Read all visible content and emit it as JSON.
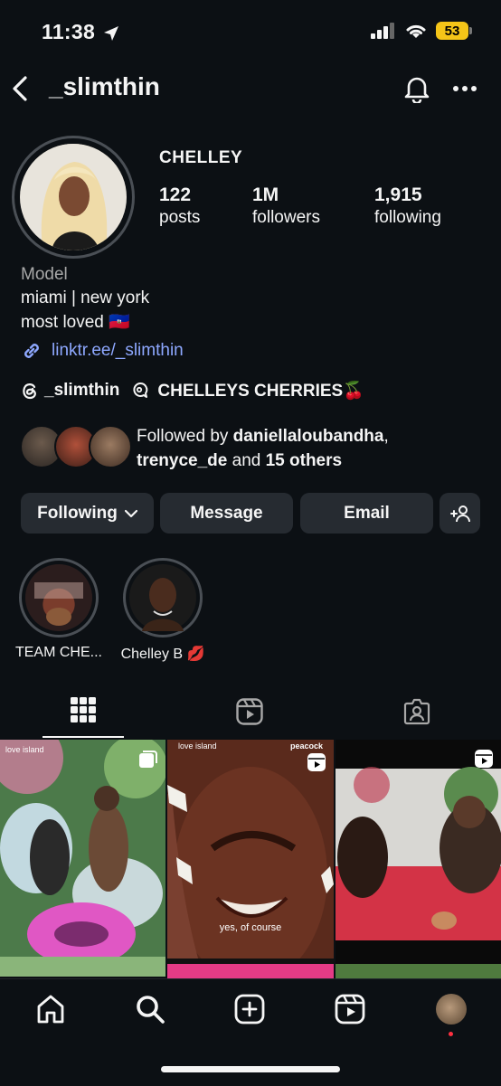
{
  "status_bar": {
    "time": "11:38",
    "battery": "53"
  },
  "header": {
    "username": "_slimthin"
  },
  "profile": {
    "display_name": "CHELLEY",
    "stats": [
      {
        "value": "122",
        "label": "posts"
      },
      {
        "value": "1M",
        "label": "followers"
      },
      {
        "value": "1,915",
        "label": "following"
      }
    ],
    "category": "Model",
    "bio_lines": [
      "miami | new york",
      "most loved 🇭🇹"
    ],
    "link": "linktr.ee/_slimthin",
    "threads_handle": "_slimthin",
    "channel_name": "CHELLEYS CHERRIES🍒",
    "followed_by": {
      "prefix": "Followed by ",
      "user1": "daniellaloubandha",
      "sep": ",",
      "user2": "trenyce_de",
      "and": " and ",
      "others": "15 others"
    }
  },
  "buttons": {
    "following": "Following",
    "message": "Message",
    "email": "Email"
  },
  "highlights": [
    {
      "label": "TEAM CHE..."
    },
    {
      "label": "Chelley B 💋"
    }
  ],
  "posts": [
    {
      "top_text": "love island",
      "caption": ""
    },
    {
      "top_text": "love island",
      "brand": "peacock",
      "caption": "yes, of course"
    },
    {
      "top_text": "",
      "caption": ""
    }
  ]
}
